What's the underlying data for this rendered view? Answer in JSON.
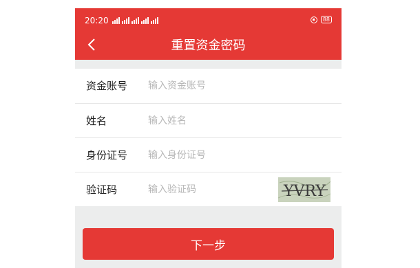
{
  "status_bar": {
    "time": "20:20",
    "battery": "88"
  },
  "header": {
    "title": "重置资金密码"
  },
  "form": {
    "fields": [
      {
        "label": "资金账号",
        "placeholder": "输入资金账号"
      },
      {
        "label": "姓名",
        "placeholder": "输入姓名"
      },
      {
        "label": "身份证号",
        "placeholder": "输入身份证号"
      },
      {
        "label": "验证码",
        "placeholder": "输入验证码"
      }
    ],
    "captcha_text": "YVRY"
  },
  "actions": {
    "next_label": "下一步"
  },
  "colors": {
    "accent": "#e53935",
    "background": "#eceded"
  }
}
